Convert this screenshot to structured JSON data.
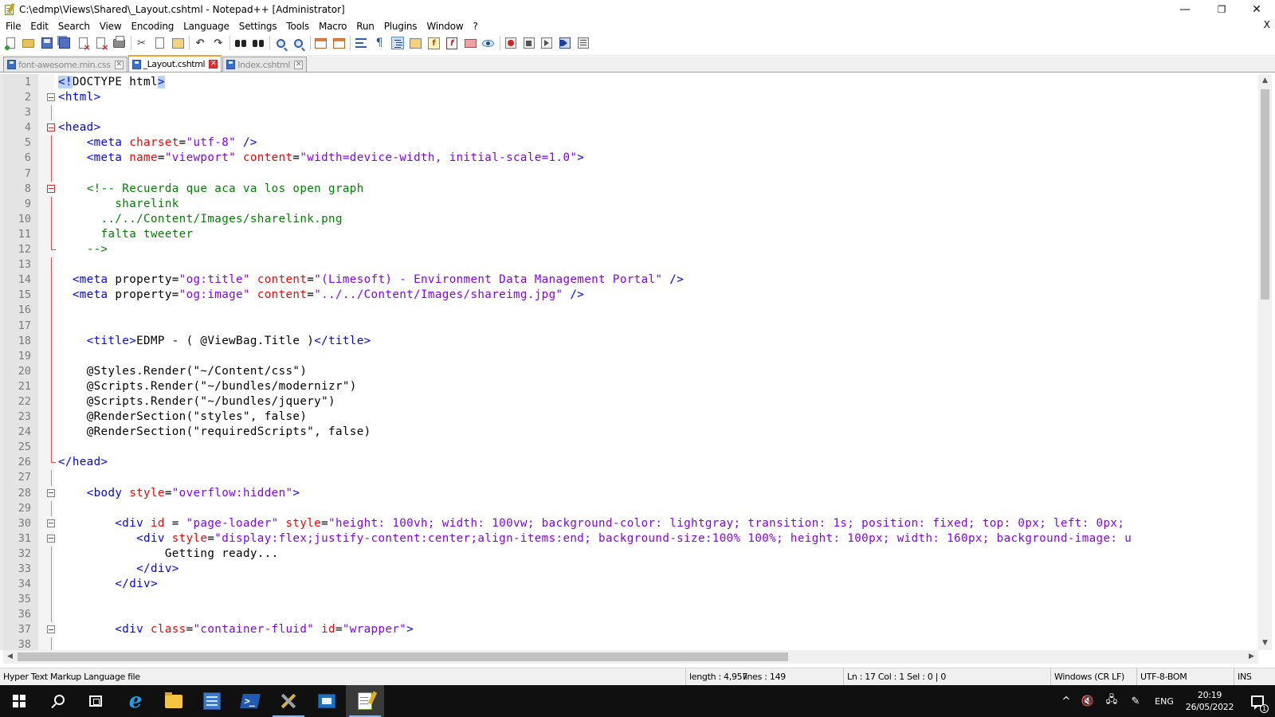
{
  "window": {
    "title": "C:\\edmp\\Views\\Shared\\_Layout.cshtml - Notepad++ [Administrator]",
    "minimize_glyph": "—",
    "restore_glyph": "❐",
    "close_glyph": "✕"
  },
  "menubar": {
    "items": [
      "File",
      "Edit",
      "Search",
      "View",
      "Encoding",
      "Language",
      "Settings",
      "Tools",
      "Macro",
      "Run",
      "Plugins",
      "Window",
      "?"
    ],
    "close_doc": "X"
  },
  "toolbar": {
    "buttons": [
      "new-file-icon",
      "open-file-icon",
      "save-icon",
      "save-all-icon",
      "close-icon",
      "close-all-icon",
      "print-icon",
      "cut-icon",
      "copy-icon",
      "paste-icon",
      "undo-icon",
      "redo-icon",
      "find-icon",
      "replace-icon",
      "zoom-in-icon",
      "zoom-out-icon",
      "sync-vertical-icon",
      "sync-horizontal-icon",
      "word-wrap-icon",
      "show-all-chars-icon",
      "indent-guide-icon",
      "doc-map-icon",
      "function-list-icon",
      "folder-as-workspace-icon",
      "monitoring-icon",
      "record-macro-icon",
      "stop-macro-icon",
      "play-macro-icon",
      "run-macro-multiple-icon",
      "save-macro-icon"
    ],
    "glyphs": {
      "cut": "✂",
      "undo": "↶",
      "redo": "↷"
    }
  },
  "tabs": [
    {
      "label": "font-awesome.min.css",
      "active": false,
      "icon": "saved-file-icon"
    },
    {
      "label": "_Layout.cshtml",
      "active": true,
      "icon": "saved-file-icon"
    },
    {
      "label": "Index.cshtml",
      "active": false,
      "icon": "saved-file-icon"
    }
  ],
  "tab_close_glyph": "✕",
  "editor": {
    "current_line": 17,
    "lines": [
      {
        "n": "1",
        "tokens": [
          [
            "<!",
            "tag hl"
          ],
          [
            "DOCTYPE html",
            "dt"
          ],
          [
            ">",
            "tag hl"
          ]
        ]
      },
      {
        "n": "2",
        "tokens": [
          [
            "<html>",
            "tag"
          ]
        ]
      },
      {
        "n": "3",
        "tokens": []
      },
      {
        "n": "4",
        "tokens": [
          [
            "<head>",
            "tag"
          ]
        ]
      },
      {
        "n": "5",
        "tokens": [
          [
            "    ",
            ""
          ],
          [
            "<meta ",
            "tag"
          ],
          [
            "charset",
            "attr"
          ],
          [
            "=",
            "dt"
          ],
          [
            "\"utf-8\"",
            "val"
          ],
          [
            " />",
            "tag"
          ]
        ]
      },
      {
        "n": "6",
        "tokens": [
          [
            "    ",
            ""
          ],
          [
            "<meta ",
            "tag"
          ],
          [
            "name",
            "attr"
          ],
          [
            "=",
            "dt"
          ],
          [
            "\"viewport\"",
            "val"
          ],
          [
            " ",
            ""
          ],
          [
            "content",
            "attr"
          ],
          [
            "=",
            "dt"
          ],
          [
            "\"width=device-width, initial-scale=1.0\"",
            "val"
          ],
          [
            ">",
            "tag"
          ]
        ]
      },
      {
        "n": "7",
        "tokens": []
      },
      {
        "n": "8",
        "tokens": [
          [
            "    ",
            ""
          ],
          [
            "<!-- Recuerda que aca va los open graph",
            "cmt"
          ]
        ]
      },
      {
        "n": "9",
        "tokens": [
          [
            "        ",
            ""
          ],
          [
            "sharelink",
            "cmt"
          ]
        ]
      },
      {
        "n": "10",
        "tokens": [
          [
            "      ",
            ""
          ],
          [
            "../../Content/Images/sharelink.png",
            "cmt"
          ]
        ]
      },
      {
        "n": "11",
        "tokens": [
          [
            "      ",
            ""
          ],
          [
            "falta tweeter",
            "cmt"
          ]
        ]
      },
      {
        "n": "12",
        "tokens": [
          [
            "    ",
            ""
          ],
          [
            "-->",
            "cmt"
          ]
        ]
      },
      {
        "n": "13",
        "tokens": []
      },
      {
        "n": "14",
        "tokens": [
          [
            "  ",
            ""
          ],
          [
            "<meta ",
            "tag"
          ],
          [
            "property",
            "dt"
          ],
          [
            "=",
            "dt"
          ],
          [
            "\"og:title\"",
            "val"
          ],
          [
            " ",
            ""
          ],
          [
            "content",
            "attr"
          ],
          [
            "=",
            "dt"
          ],
          [
            "\"(Limesoft) - Environment Data Management Portal\"",
            "val"
          ],
          [
            " />",
            "tag"
          ]
        ]
      },
      {
        "n": "15",
        "tokens": [
          [
            "  ",
            ""
          ],
          [
            "<meta ",
            "tag"
          ],
          [
            "property",
            "dt"
          ],
          [
            "=",
            "dt"
          ],
          [
            "\"og:image\"",
            "val"
          ],
          [
            " ",
            ""
          ],
          [
            "content",
            "attr"
          ],
          [
            "=",
            "dt"
          ],
          [
            "\"../../Content/Images/shareimg.jpg\"",
            "val"
          ],
          [
            " />",
            "tag"
          ]
        ]
      },
      {
        "n": "16",
        "tokens": []
      },
      {
        "n": "17",
        "tokens": []
      },
      {
        "n": "18",
        "tokens": [
          [
            "    ",
            ""
          ],
          [
            "<title>",
            "tag"
          ],
          [
            "EDMP - ( @ViewBag.Title )",
            "dt"
          ],
          [
            "</title>",
            "tag"
          ]
        ]
      },
      {
        "n": "19",
        "tokens": []
      },
      {
        "n": "20",
        "tokens": [
          [
            "    ",
            ""
          ],
          [
            "@Styles.Render(\"~/Content/css\")",
            "dt"
          ]
        ]
      },
      {
        "n": "21",
        "tokens": [
          [
            "    ",
            ""
          ],
          [
            "@Scripts.Render(\"~/bundles/modernizr\")",
            "dt"
          ]
        ]
      },
      {
        "n": "22",
        "tokens": [
          [
            "    ",
            ""
          ],
          [
            "@Scripts.Render(\"~/bundles/jquery\")",
            "dt"
          ]
        ]
      },
      {
        "n": "23",
        "tokens": [
          [
            "    ",
            ""
          ],
          [
            "@RenderSection(\"styles\", false)",
            "dt"
          ]
        ]
      },
      {
        "n": "24",
        "tokens": [
          [
            "    ",
            ""
          ],
          [
            "@RenderSection(\"requiredScripts\", false)",
            "dt"
          ]
        ]
      },
      {
        "n": "25",
        "tokens": []
      },
      {
        "n": "26",
        "tokens": [
          [
            "</head>",
            "tag"
          ]
        ]
      },
      {
        "n": "27",
        "tokens": []
      },
      {
        "n": "28",
        "tokens": [
          [
            "    ",
            ""
          ],
          [
            "<body ",
            "tag"
          ],
          [
            "style",
            "attr"
          ],
          [
            "=",
            "dt"
          ],
          [
            "\"overflow:hidden\"",
            "val"
          ],
          [
            ">",
            "tag"
          ]
        ]
      },
      {
        "n": "29",
        "tokens": []
      },
      {
        "n": "30",
        "tokens": [
          [
            "        ",
            ""
          ],
          [
            "<div ",
            "tag"
          ],
          [
            "id",
            "attr"
          ],
          [
            " = ",
            "dt"
          ],
          [
            "\"page-loader\"",
            "val"
          ],
          [
            " ",
            ""
          ],
          [
            "style",
            "attr"
          ],
          [
            "=",
            "dt"
          ],
          [
            "\"height: 100vh; width: 100vw; background-color: lightgray; transition: 1s; position: fixed; top: 0px; left: 0px;",
            "val"
          ]
        ]
      },
      {
        "n": "31",
        "tokens": [
          [
            "           ",
            ""
          ],
          [
            "<div ",
            "tag"
          ],
          [
            "style",
            "attr"
          ],
          [
            "=",
            "dt"
          ],
          [
            "\"display:flex;justify-content:center;align-items:end; background-size:100% 100%; height: 100px; width: 160px; background-image: u",
            "val"
          ]
        ]
      },
      {
        "n": "32",
        "tokens": [
          [
            "               ",
            ""
          ],
          [
            "Getting ready...",
            "dt"
          ]
        ]
      },
      {
        "n": "33",
        "tokens": [
          [
            "           ",
            ""
          ],
          [
            "</div>",
            "tag"
          ]
        ]
      },
      {
        "n": "34",
        "tokens": [
          [
            "        ",
            ""
          ],
          [
            "</div>",
            "tag"
          ]
        ]
      },
      {
        "n": "35",
        "tokens": []
      },
      {
        "n": "36",
        "tokens": []
      },
      {
        "n": "37",
        "tokens": [
          [
            "        ",
            ""
          ],
          [
            "<div ",
            "tag"
          ],
          [
            "class",
            "attr"
          ],
          [
            "=",
            "dt"
          ],
          [
            "\"container-fluid\"",
            "val"
          ],
          [
            " ",
            ""
          ],
          [
            "id",
            "attr"
          ],
          [
            "=",
            "dt"
          ],
          [
            "\"wrapper\"",
            "val"
          ],
          [
            ">",
            "tag"
          ]
        ]
      },
      {
        "n": "38",
        "tokens": []
      }
    ]
  },
  "statusbar": {
    "file_type": "Hyper Text Markup Language file",
    "length": "length : 4,957",
    "lines": "lines : 149",
    "position": "Ln : 17    Col : 1    Sel : 0 | 0",
    "eol": "Windows (CR LF)",
    "encoding": "UTF-8-BOM",
    "mode": "INS"
  },
  "taskbar": {
    "apps": [
      "start-button",
      "search-button",
      "task-view-button",
      "internet-explorer",
      "file-explorer",
      "server-manager",
      "powershell",
      "admin-tools",
      "remote-desktop",
      "notepad-plus-plus"
    ],
    "active_app": "notepad-plus-plus",
    "tray": {
      "chevron": "^",
      "volume": "🔇",
      "language": "ENG",
      "time": "20:19",
      "date": "26/05/2022",
      "notifications": "1"
    }
  },
  "colors": {
    "tag": "#0000ff",
    "attribute": "#ff0000",
    "value": "#8000ff",
    "comment": "#008000",
    "current_line": "#e8e8ff",
    "active_tab_accent": "#f0a030"
  }
}
